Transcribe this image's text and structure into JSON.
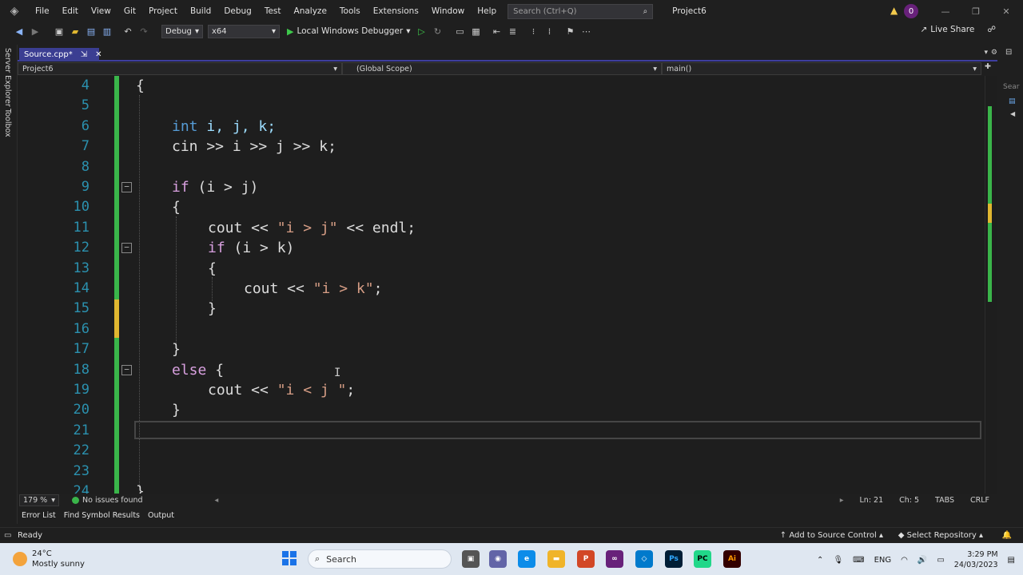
{
  "menu": [
    "File",
    "Edit",
    "View",
    "Git",
    "Project",
    "Build",
    "Debug",
    "Test",
    "Analyze",
    "Tools",
    "Extensions",
    "Window",
    "Help"
  ],
  "search_placeholder": "Search (Ctrl+Q)",
  "project_title": "Project6",
  "notification_count": "0",
  "toolbar": {
    "config": "Debug",
    "platform": "x64",
    "debugger": "Local Windows Debugger",
    "live_share": "Live Share"
  },
  "side_tabs": [
    "Server Explorer",
    "Toolbox"
  ],
  "doc_tab": {
    "name": "Source.cpp*",
    "pin": "⇲",
    "close": "✕"
  },
  "nav": {
    "project": "Project6",
    "scope": "(Global Scope)",
    "member": "main()"
  },
  "right_strip_label": "Sear",
  "code_lines": [
    {
      "n": "4"
    },
    {
      "n": "5"
    },
    {
      "n": "6"
    },
    {
      "n": "7"
    },
    {
      "n": "8"
    },
    {
      "n": "9"
    },
    {
      "n": "10"
    },
    {
      "n": "11"
    },
    {
      "n": "12"
    },
    {
      "n": "13"
    },
    {
      "n": "14"
    },
    {
      "n": "15"
    },
    {
      "n": "16"
    },
    {
      "n": "17"
    },
    {
      "n": "18"
    },
    {
      "n": "19"
    },
    {
      "n": "20"
    },
    {
      "n": "21"
    },
    {
      "n": "22"
    },
    {
      "n": "23"
    },
    {
      "n": "24"
    }
  ],
  "code_text": {
    "l4": "{",
    "l6_kw": "int",
    "l6_vars": "i, j, k;",
    "l7": "cin >> i >> j >> k;",
    "l9_kw": "if",
    "l9_rest": "(i > j)",
    "l10": "{",
    "l11_a": "cout << ",
    "l11_str": "\"i > j\"",
    "l11_b": " << endl;",
    "l12_kw": "if",
    "l12_rest": "(i > k)",
    "l13": "{",
    "l14_a": "cout << ",
    "l14_str": "\"i > k\"",
    "l14_b": ";",
    "l15": "}",
    "l17": "}",
    "l18_kw": "else",
    "l18_rest": " {",
    "l19_a": "cout << ",
    "l19_str": "\"i < j \"",
    "l19_b": ";",
    "l20": "}",
    "l24": "}"
  },
  "status": {
    "zoom": "179 %",
    "issues": "No issues found",
    "ln": "Ln: 21",
    "ch": "Ch: 5",
    "tabs": "TABS",
    "eol": "CRLF"
  },
  "panels": [
    "Error List",
    "Find Symbol Results",
    "Output"
  ],
  "bottom": {
    "ready": "Ready",
    "source_control": "Add to Source Control",
    "repo": "Select Repository"
  },
  "taskbar": {
    "temp": "24°C",
    "weather": "Mostly sunny",
    "search": "Search",
    "lang": "ENG",
    "time": "3:29 PM",
    "date": "24/03/2023"
  },
  "colors": {
    "accent_tab": "#3b3e92",
    "change_bar": "#3ab54a",
    "unsaved_bar": "#e0b730",
    "line_number": "#2b91af"
  }
}
